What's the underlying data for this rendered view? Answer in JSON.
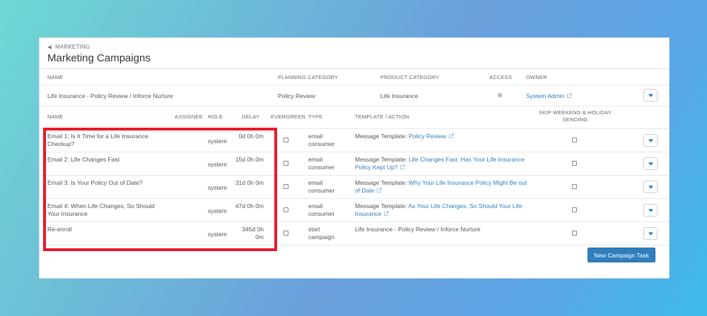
{
  "header": {
    "breadcrumb": "MARKETING",
    "title": "Marketing Campaigns"
  },
  "campaign_table": {
    "columns": {
      "name": "NAME",
      "planning_category": "PLANNING CATEGORY",
      "product_category": "PRODUCT CATEGORY",
      "access": "ACCESS",
      "owner": "OWNER"
    },
    "row": {
      "name": "Life Insurance - Policy Review / Inforce Nurture",
      "planning_category": "Policy Review",
      "product_category": "Life Insurance",
      "owner": "System Admin"
    }
  },
  "task_table": {
    "columns": {
      "name": "NAME",
      "assignee": "ASSIGNEE",
      "role": "ROLE",
      "delay": "DELAY",
      "evergreen": "EVERGREEN",
      "type": "TYPE",
      "template": "TEMPLATE / ACTION",
      "skip_weekend": "SKIP WEEKEND & HOLIDAY SENDING"
    },
    "rows": [
      {
        "name": "Email 1: Is It Time for a Life Insurance Checkup?",
        "role": "system",
        "delay": "0d 0h 0m",
        "type": "email consumer",
        "template_prefix": "Message Template:",
        "template_link": "Policy Review"
      },
      {
        "name": "Email 2: Life Changes Fast",
        "role": "system",
        "delay": "15d 0h 0m",
        "type": "email consumer",
        "template_prefix": "Message Template:",
        "template_link": "Life Changes Fast. Has Your Life Insurance Policy Kept Up?"
      },
      {
        "name": "Email 3: Is Your Policy Out of Date?",
        "role": "system",
        "delay": "31d 0h 0m",
        "type": "email consumer",
        "template_prefix": "Message Template:",
        "template_link": "Why Your Life Insurance Policy Might Be out of Date"
      },
      {
        "name": "Email 4: When Life Changes, So Should Your Insurance",
        "role": "system",
        "delay": "47d 0h 0m",
        "type": "email consumer",
        "template_prefix": "Message Template:",
        "template_link": "As Your Life Changes, So Should Your Life Insurance"
      },
      {
        "name": "Re-enroll",
        "role": "system",
        "delay": "345d 0h 0m",
        "type": "start campaign",
        "template_prefix": "Life Insurance - Policy Review / Inforce Nurture",
        "template_link": ""
      }
    ]
  },
  "actions": {
    "new_task": "New Campaign Task"
  },
  "colors": {
    "link": "#2b7ec2",
    "primary_button": "#2f7fbf",
    "highlight": "#e8192c"
  }
}
